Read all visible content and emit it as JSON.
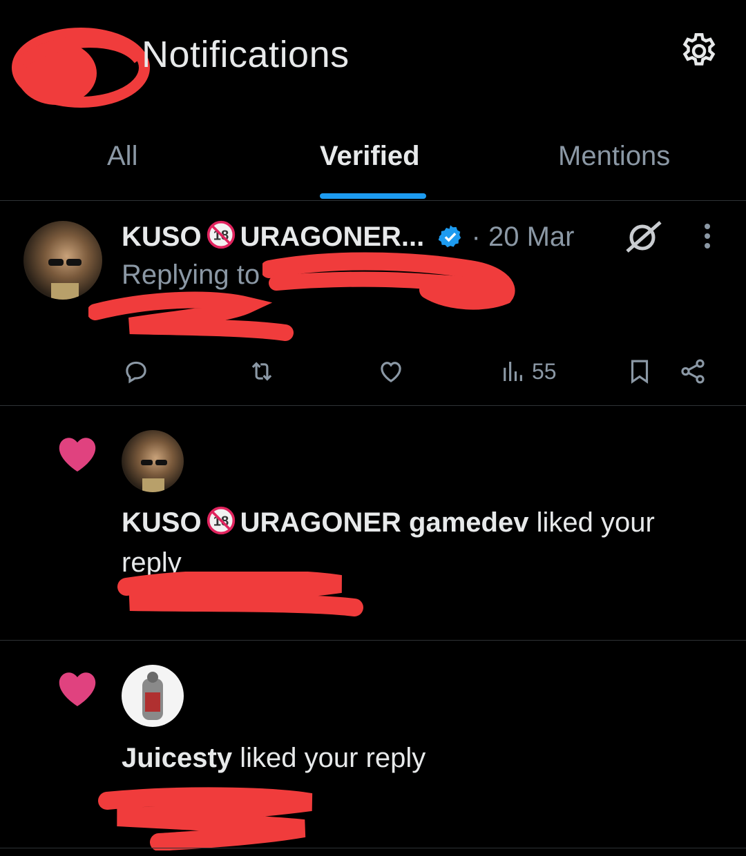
{
  "header": {
    "title": "Notifications",
    "settings_icon": "gear-icon"
  },
  "tabs": [
    {
      "label": "All",
      "active": false
    },
    {
      "label": "Verified",
      "active": true
    },
    {
      "label": "Mentions",
      "active": false
    }
  ],
  "accent_color": "#1d9bf0",
  "like_color": "#e0427f",
  "reply_item": {
    "display_name_start": "KUSO",
    "display_name_end": "URAGONER...",
    "badge_icon": "18-plus-icon",
    "verified_icon": "verified-badge-icon",
    "separator": "·",
    "date": "20 Mar",
    "replying_to_prefix": "Replying to",
    "views": "55",
    "actions": [
      "reply-icon",
      "retweet-icon",
      "like-icon",
      "views-icon",
      "bookmark-icon",
      "share-icon"
    ]
  },
  "like_notifications": [
    {
      "name_start": "KUSO",
      "name_end": "URAGONER gamedev",
      "action_text": " liked your reply"
    },
    {
      "name_start": "Juicesty",
      "name_end": "",
      "action_text": " liked your reply"
    }
  ]
}
